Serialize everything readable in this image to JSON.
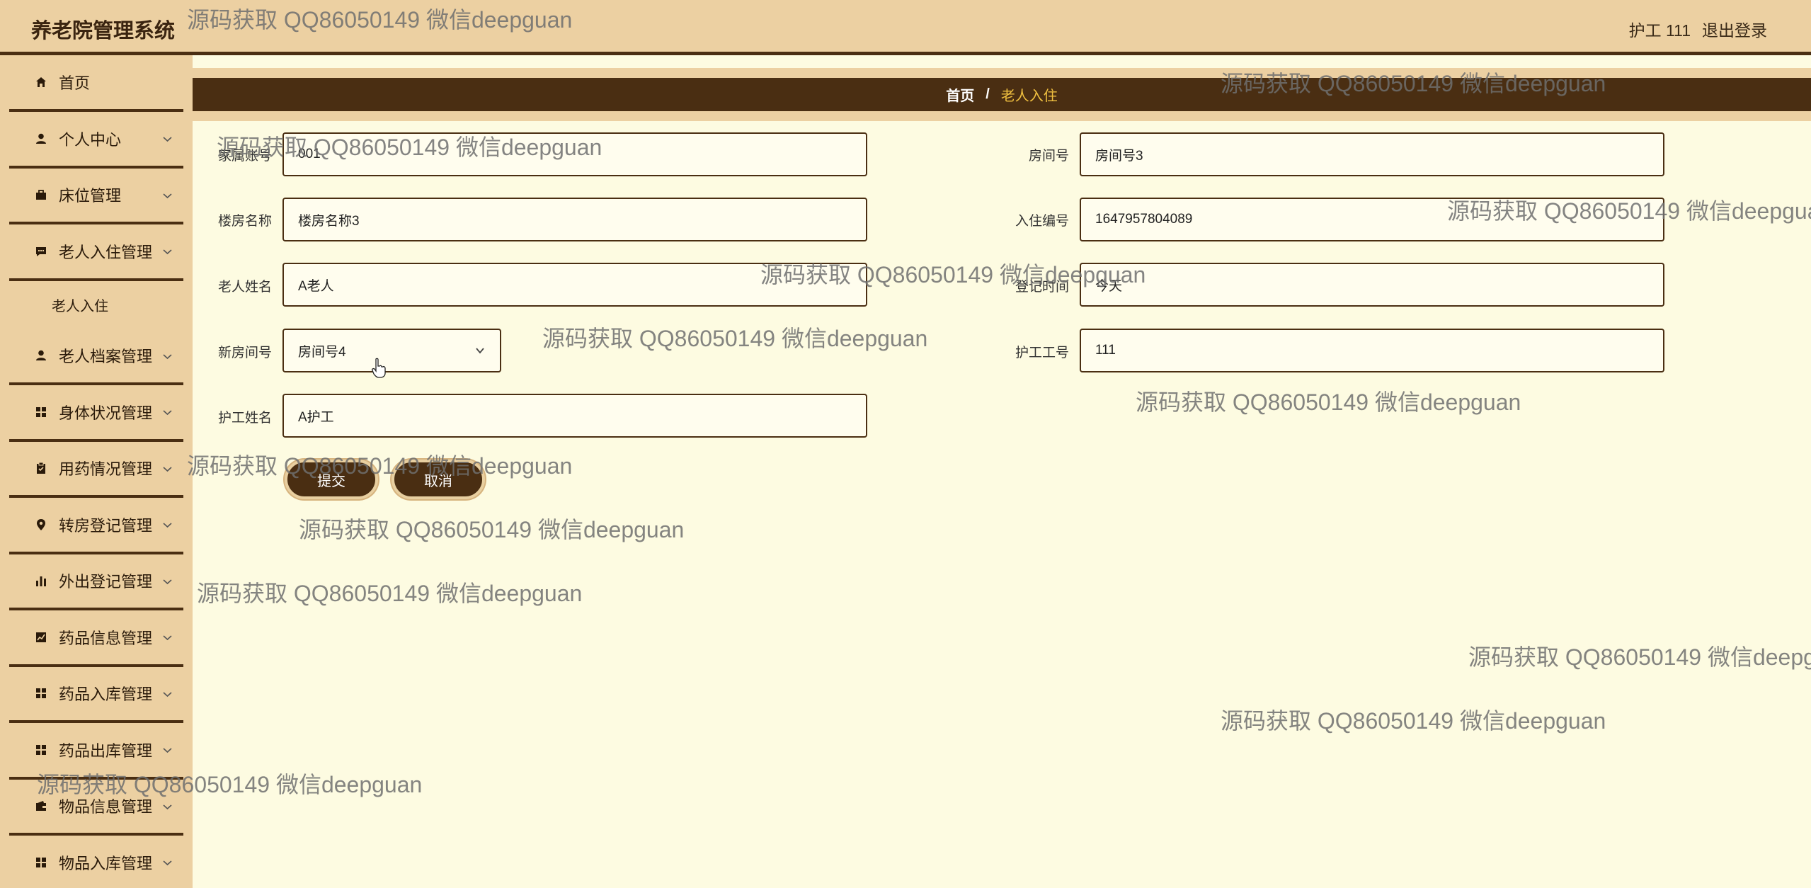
{
  "header": {
    "title": "养老院管理系统",
    "user": "护工 111",
    "logout": "退出登录"
  },
  "sidebar": {
    "items": [
      {
        "label": "首页",
        "icon": "home-icon"
      },
      {
        "label": "个人中心",
        "icon": "user-icon"
      },
      {
        "label": "床位管理",
        "icon": "briefcase-icon"
      },
      {
        "label": "老人入住管理",
        "icon": "chat-icon"
      },
      {
        "label": "老人档案管理",
        "icon": "user-icon"
      },
      {
        "label": "身体状况管理",
        "icon": "grid-icon"
      },
      {
        "label": "用药情况管理",
        "icon": "clipboard-icon"
      },
      {
        "label": "转房登记管理",
        "icon": "location-icon"
      },
      {
        "label": "外出登记管理",
        "icon": "bar-chart-icon"
      },
      {
        "label": "药品信息管理",
        "icon": "line-chart-icon"
      },
      {
        "label": "药品入库管理",
        "icon": "grid-icon"
      },
      {
        "label": "药品出库管理",
        "icon": "grid-icon"
      },
      {
        "label": "物品信息管理",
        "icon": "wallet-icon"
      },
      {
        "label": "物品入库管理",
        "icon": "grid-icon"
      }
    ],
    "subitem": "老人入住"
  },
  "breadcrumb": {
    "home": "首页",
    "sep": "/",
    "current": "老人入住"
  },
  "form": {
    "family_account_label": "家属账号",
    "family_account_value": "001",
    "room_no_label": "房间号",
    "room_no_value": "房间号3",
    "building_label": "楼房名称",
    "building_value": "楼房名称3",
    "checkin_no_label": "入住编号",
    "checkin_no_value": "1647957804089",
    "elder_name_label": "老人姓名",
    "elder_name_value": "A老人",
    "reg_time_label": "登记时间",
    "reg_time_value": "今天",
    "new_room_label": "新房间号",
    "new_room_value": "房间号4",
    "nurse_no_label": "护工工号",
    "nurse_no_value": "111",
    "nurse_name_label": "护工姓名",
    "nurse_name_value": "A护工",
    "submit": "提交",
    "cancel": "取消"
  },
  "watermark": "源码获取 QQ86050149 微信deepguan",
  "colors": {
    "accent_dark": "#4a2e12",
    "header_bg": "#ecd0a2",
    "page_bg": "#fdfbe1",
    "breadcrumb_current": "#f0c040"
  }
}
